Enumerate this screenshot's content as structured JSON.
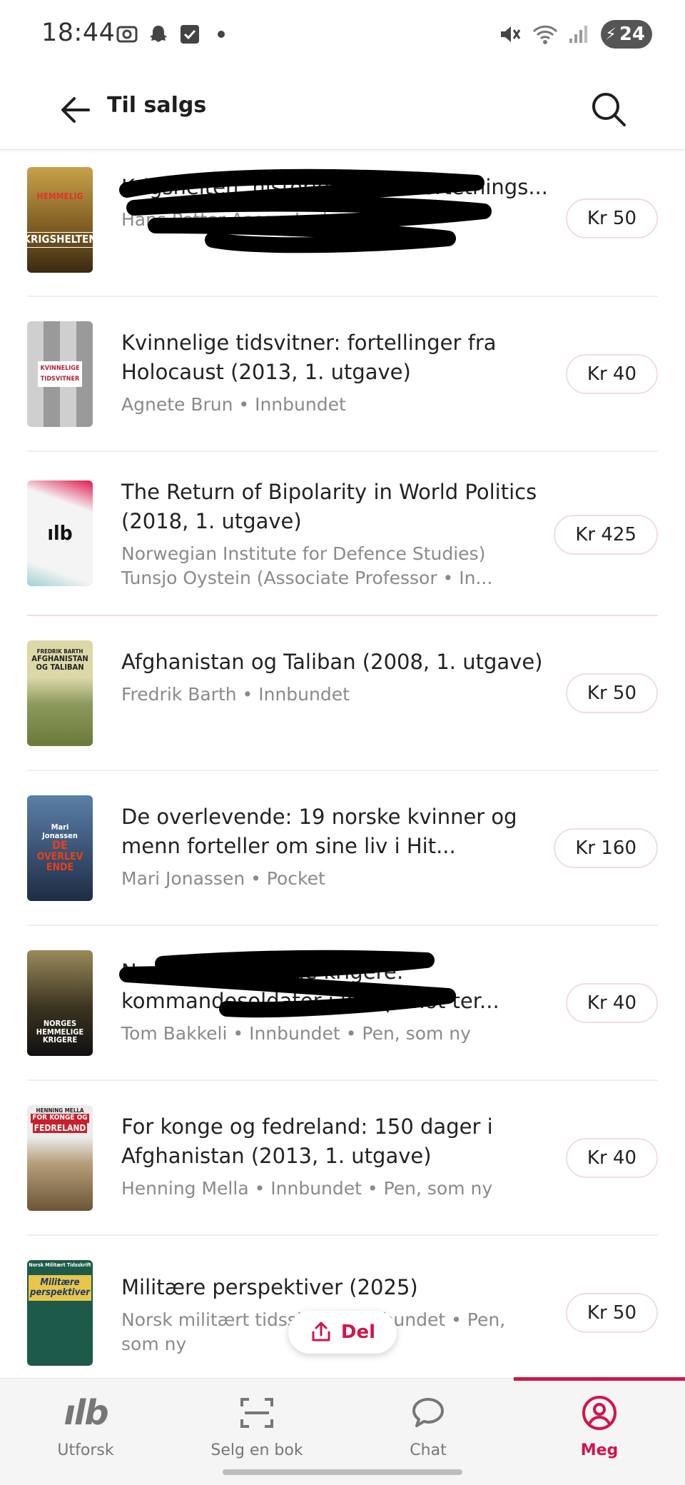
{
  "status_bar": {
    "time": "18:44",
    "battery_level": "24",
    "icons_left": [
      "screenshot-icon",
      "snapchat-icon",
      "checkbox-icon",
      "dot-icon"
    ],
    "icons_right": [
      "mute-icon",
      "wifi-icon",
      "signal-icon",
      "battery-icon"
    ]
  },
  "header": {
    "title": "Til salgs",
    "back_icon": "arrow-left-icon",
    "search_icon": "search-icon"
  },
  "books": [
    {
      "title": "Krigshelten: historien om ... fortetnings...",
      "author": "Hans Petter Aass • Innbundet",
      "author2": "",
      "price": "Kr 50",
      "cover_lines": [
        "KRIGSHELTEN"
      ],
      "cover_bg": "#8a6a2a",
      "redacted": true
    },
    {
      "title": "Kvinnelige tidsvitner: fortellinger fra Holocaust (2013, 1. utgave)",
      "author": "Agnete Brun • Innbundet",
      "author2": "",
      "price": "Kr 40",
      "cover_lines": [
        "KVINNELIGE",
        "TIDSVITNER"
      ],
      "cover_bg": "#e8e8e8",
      "redacted": false
    },
    {
      "title": "The Return of Bipolarity in World Politics (2018, 1. utgave)",
      "author": "Norwegian Institute for Defence Studies)",
      "author2": "Tunsjo Oystein (Associate Professor • In...",
      "price": "Kr 425",
      "cover_lines": [
        "ılb"
      ],
      "cover_bg": "#f4f4f4",
      "redacted": false
    },
    {
      "title": "Afghanistan og Taliban (2008, 1. utgave)",
      "author": "Fredrik Barth • Innbundet",
      "author2": "",
      "price": "Kr 50",
      "cover_lines": [
        "FREDRIK BARTH",
        "AFGHANISTAN",
        "OG TALIBAN"
      ],
      "cover_bg": "#a9ad7a",
      "redacted": false
    },
    {
      "title": "De overlevende: 19 norske kvinner og menn forteller om sine liv i Hit...",
      "author": "Mari Jonassen • Pocket",
      "author2": "",
      "price": "Kr 160",
      "cover_lines": [
        "Mari",
        "Jonassen",
        "DE",
        "OVERLEV",
        "ENDE"
      ],
      "cover_bg": "#2a3a55",
      "redacted": false
    },
    {
      "title": "Norges hemmelige krigere: kommandosoldater i kamp mot ter...",
      "author": "Tom Bakkeli • Innbundet • Pen, som ny",
      "author2": "",
      "price": "Kr 40",
      "cover_lines": [
        "NORGES",
        "HEMMELIGE",
        "KRIGERE"
      ],
      "cover_bg": "#3b3a2a",
      "redacted": true
    },
    {
      "title": "For konge og fedreland: 150 dager i Afghanistan (2013, 1. utgave)",
      "author": "Henning Mella • Innbundet • Pen, som ny",
      "author2": "",
      "price": "Kr 40",
      "cover_lines": [
        "HENNING MELLA",
        "FOR KONGE OG",
        "FEDRELAND"
      ],
      "cover_bg": "#c9b79a",
      "redacted": false
    },
    {
      "title": "Militære perspektiver (2025)",
      "author": "Norsk militært tidsskrift • Innbundet • Pen,",
      "author2": "som ny",
      "price": "Kr 50",
      "cover_lines": [
        "Norsk Militært Tidsskrift",
        "Militære",
        "perspektiver"
      ],
      "cover_bg": "#1d5a4a",
      "redacted": false
    }
  ],
  "share_button": {
    "label": "Del",
    "icon": "share-icon"
  },
  "bottom_nav": [
    {
      "label": "Utforsk",
      "icon": "explore-logo-icon",
      "active": false
    },
    {
      "label": "Selg en bok",
      "icon": "scan-icon",
      "active": false
    },
    {
      "label": "Chat",
      "icon": "chat-bubble-icon",
      "active": false
    },
    {
      "label": "Meg",
      "icon": "profile-icon",
      "active": true
    }
  ],
  "colors": {
    "accent": "#d0154a",
    "text": "#222222",
    "muted": "#8a8a8a"
  }
}
